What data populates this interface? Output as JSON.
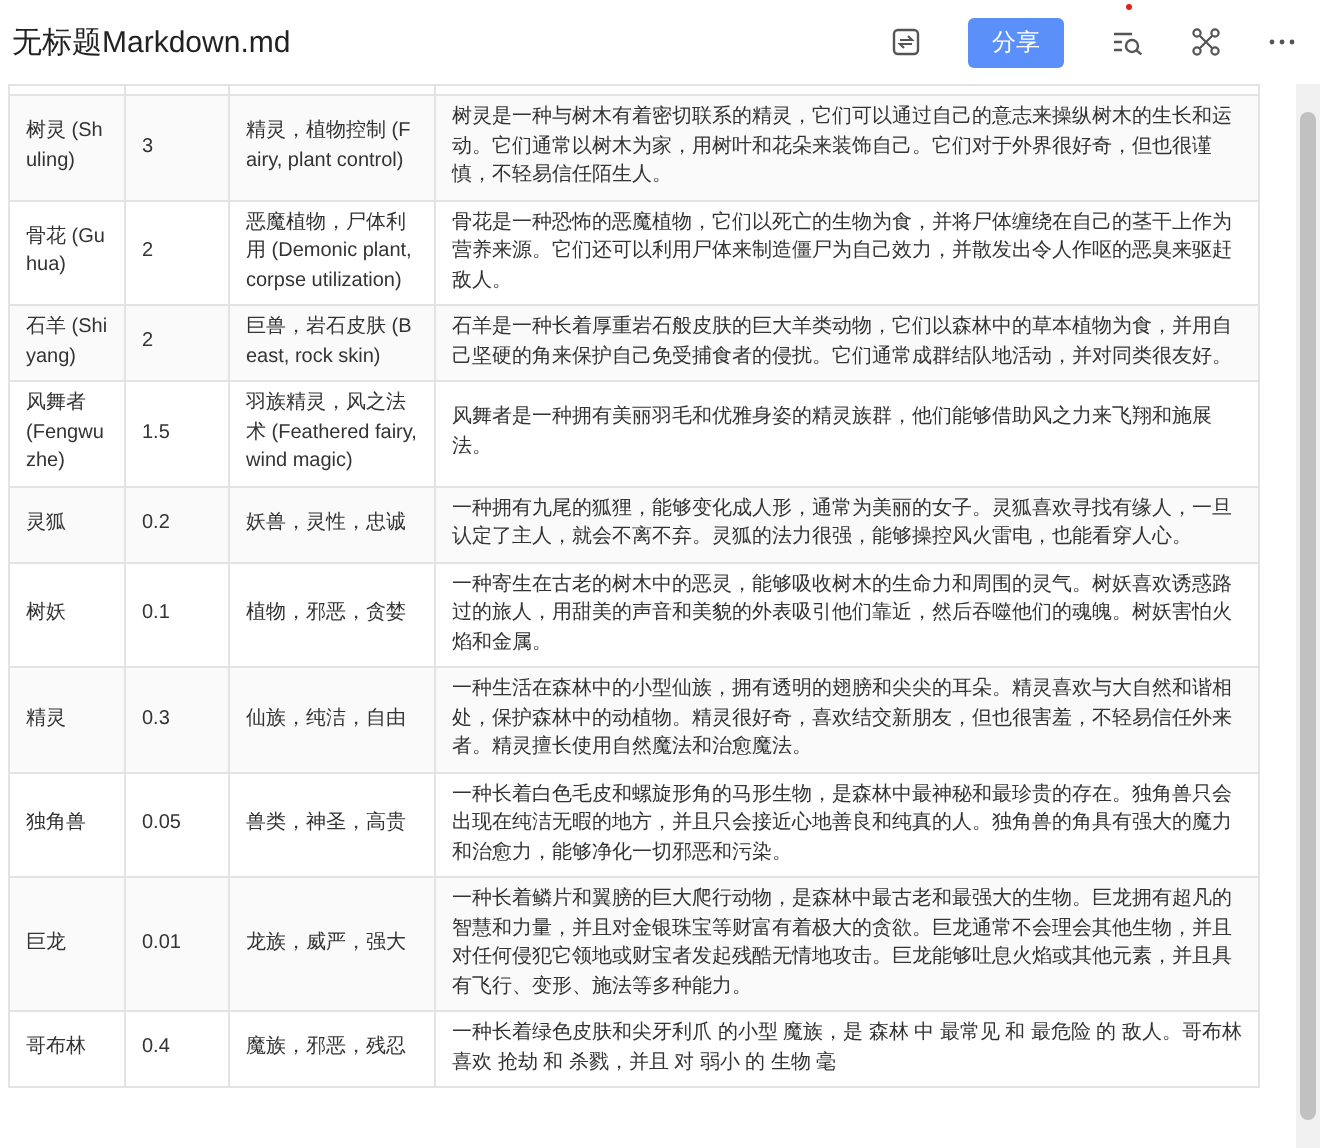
{
  "title": "无标题Markdown.md",
  "toolbar": {
    "share_label": "分享",
    "has_notification": true
  },
  "rows": [
    {
      "name": "树灵 (Shuling)",
      "value": "3",
      "tags": "精灵，植物控制 (Fairy, plant control)",
      "description": "树灵是一种与树木有着密切联系的精灵，它们可以通过自己的意志来操纵树木的生长和运动。它们通常以树木为家，用树叶和花朵来装饰自己。它们对于外界很好奇，但也很谨慎，不轻易信任陌生人。"
    },
    {
      "name": "骨花 (Guhua)",
      "value": "2",
      "tags": "恶魔植物，尸体利用 (Demonic plant, corpse utilization)",
      "description": "骨花是一种恐怖的恶魔植物，它们以死亡的生物为食，并将尸体缠绕在自己的茎干上作为营养来源。它们还可以利用尸体来制造僵尸为自己效力，并散发出令人作呕的恶臭来驱赶敌人。"
    },
    {
      "name": "石羊 (Shiyang)",
      "value": "2",
      "tags": "巨兽，岩石皮肤 (Beast, rock skin)",
      "description": "石羊是一种长着厚重岩石般皮肤的巨大羊类动物，它们以森林中的草本植物为食，并用自己坚硬的角来保护自己免受捕食者的侵扰。它们通常成群结队地活动，并对同类很友好。"
    },
    {
      "name": "风舞者 (Fengwuzhe)",
      "value": "1.5",
      "tags": "羽族精灵，风之法术 (Feathered fairy, wind magic)",
      "description": "风舞者是一种拥有美丽羽毛和优雅身姿的精灵族群，他们能够借助风之力来飞翔和施展法。"
    },
    {
      "name": "灵狐",
      "value": "0.2",
      "tags": "妖兽，灵性，忠诚",
      "description": "一种拥有九尾的狐狸，能够变化成人形，通常为美丽的女子。灵狐喜欢寻找有缘人，一旦认定了主人，就会不离不弃。灵狐的法力很强，能够操控风火雷电，也能看穿人心。"
    },
    {
      "name": "树妖",
      "value": "0.1",
      "tags": "植物，邪恶，贪婪",
      "description": "一种寄生在古老的树木中的恶灵，能够吸收树木的生命力和周围的灵气。树妖喜欢诱惑路过的旅人，用甜美的声音和美貌的外表吸引他们靠近，然后吞噬他们的魂魄。树妖害怕火焰和金属。"
    },
    {
      "name": "精灵",
      "value": "0.3",
      "tags": "仙族，纯洁，自由",
      "description": "一种生活在森林中的小型仙族，拥有透明的翅膀和尖尖的耳朵。精灵喜欢与大自然和谐相处，保护森林中的动植物。精灵很好奇，喜欢结交新朋友，但也很害羞，不轻易信任外来者。精灵擅长使用自然魔法和治愈魔法。"
    },
    {
      "name": "独角兽",
      "value": "0.05",
      "tags": "兽类，神圣，高贵",
      "description": "一种长着白色毛皮和螺旋形角的马形生物，是森林中最神秘和最珍贵的存在。独角兽只会出现在纯洁无暇的地方，并且只会接近心地善良和纯真的人。独角兽的角具有强大的魔力和治愈力，能够净化一切邪恶和污染。"
    },
    {
      "name": "巨龙",
      "value": "0.01",
      "tags": "龙族，威严，强大",
      "description": "一种长着鳞片和翼膀的巨大爬行动物，是森林中最古老和最强大的生物。巨龙拥有超凡的智慧和力量，并且对金银珠宝等财富有着极大的贪欲。巨龙通常不会理会其他生物，并且对任何侵犯它领地或财宝者发起残酷无情地攻击。巨龙能够吐息火焰或其他元素，并且具有飞行、变形、施法等多种能力。"
    },
    {
      "name": "哥布林",
      "value": "0.4",
      "tags": "魔族，邪恶，残忍",
      "description": "一种长着绿色皮肤和尖牙利爪 的小型 魔族，是 森林 中 最常见 和 最危险 的 敌人。哥布林喜欢 抢劫 和 杀戮，并且 对 弱小 的 生物 毫"
    }
  ]
}
